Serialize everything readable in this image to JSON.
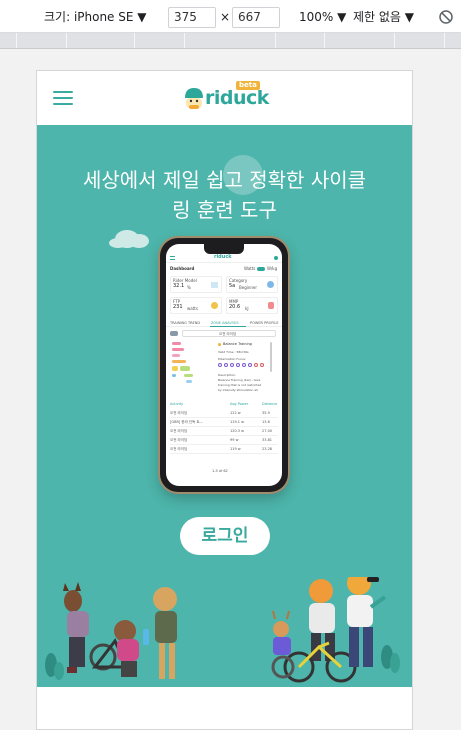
{
  "devtools": {
    "device_label": "크기: iPhone SE ▼",
    "width_value": "375",
    "times_sign": "×",
    "height_value": "667",
    "zoom_label": "100% ▼",
    "throttle_label": "제한 없음 ▼"
  },
  "header": {
    "logo_text": "riduck",
    "beta_badge": "beta"
  },
  "hero": {
    "headline_line1": "세상에서 제일 쉽고 정확한 사이클",
    "headline_line2": "링 훈련 도구",
    "login_label": "로그인"
  },
  "phone_screen": {
    "title": "Dashboard",
    "toggle_a": "Watts",
    "toggle_b": "W/kg",
    "card1_label": "Rider Model",
    "card1_value": "32.1",
    "card1_unit": "%",
    "card2_label": "Category",
    "card2_value": "5a",
    "card2_unit": "Beginner",
    "card3_label": "FTP",
    "card3_value": "231",
    "card3_unit": "watts",
    "card4_label": "MMP",
    "card4_value": "20.6",
    "card4_unit": "kJ",
    "tab1": "TRAINING TREND",
    "tab2": "ZONE ANALYSIS",
    "tab3": "POWER PROFILE",
    "button_text": "오전 라이딩",
    "zone_title": "Balance Training",
    "zone_line1": "Valid Time : 58m36s",
    "zone_line2": "Polarization Focus:",
    "zone_desc_title": "Description:",
    "zone_desc1": "Balance Training (bal) - Give",
    "zone_desc2": "training that is not restricted",
    "zone_desc3": "by intensity stimulation all",
    "table_h1": "Activity",
    "table_h2": "Avg Power",
    "table_h3": "Distance",
    "rows": [
      {
        "name": "오전 라이딩",
        "power": "122 w",
        "dist": "35.9"
      },
      {
        "name": "[GBR] 한라 단독 트...",
        "power": "119.1 w",
        "dist": "13.6"
      },
      {
        "name": "오전 라이딩",
        "power": "120.3 w",
        "dist": "27.00"
      },
      {
        "name": "오전 라이딩",
        "power": "99 w",
        "dist": "33.81"
      },
      {
        "name": "오전 라이딩",
        "power": "119 w",
        "dist": "23.28"
      }
    ],
    "pagination": "1-5 of 62"
  },
  "colors": {
    "brand": "#2ea79b",
    "hero_bg": "#4db5ab",
    "beta": "#f0b43b"
  }
}
